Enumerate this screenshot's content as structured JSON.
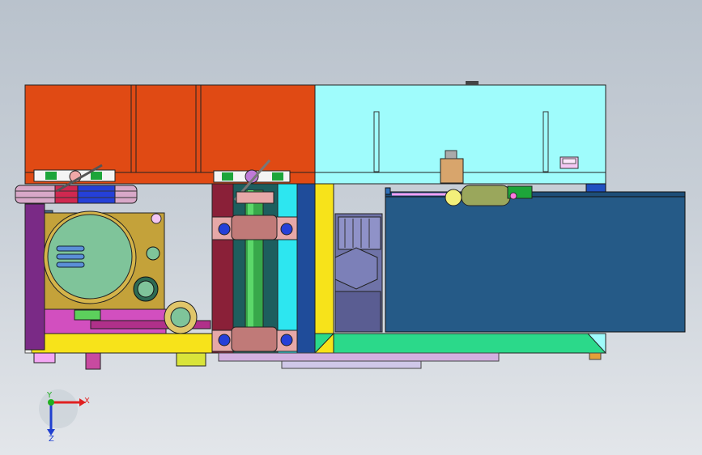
{
  "viewport": {
    "background_top": "#b9c2cc",
    "background_bottom": "#e3e6ea"
  },
  "triad": {
    "x_label": "X",
    "y_label": "Y",
    "z_label": "Z",
    "x_color": "#e02020",
    "y_color": "#20b020",
    "z_color": "#2040d0"
  },
  "parts": {
    "top_cover_left_color": "#e04a14",
    "top_cover_right_color": "#9ffcfc",
    "hopper_color": "#255a87",
    "motor_color": "#7fc49a",
    "base_color": "#f7e31a",
    "conveyor_color": "#2bd98a",
    "shaft_color": "#38a84a",
    "frame_color": "#8a2038"
  }
}
